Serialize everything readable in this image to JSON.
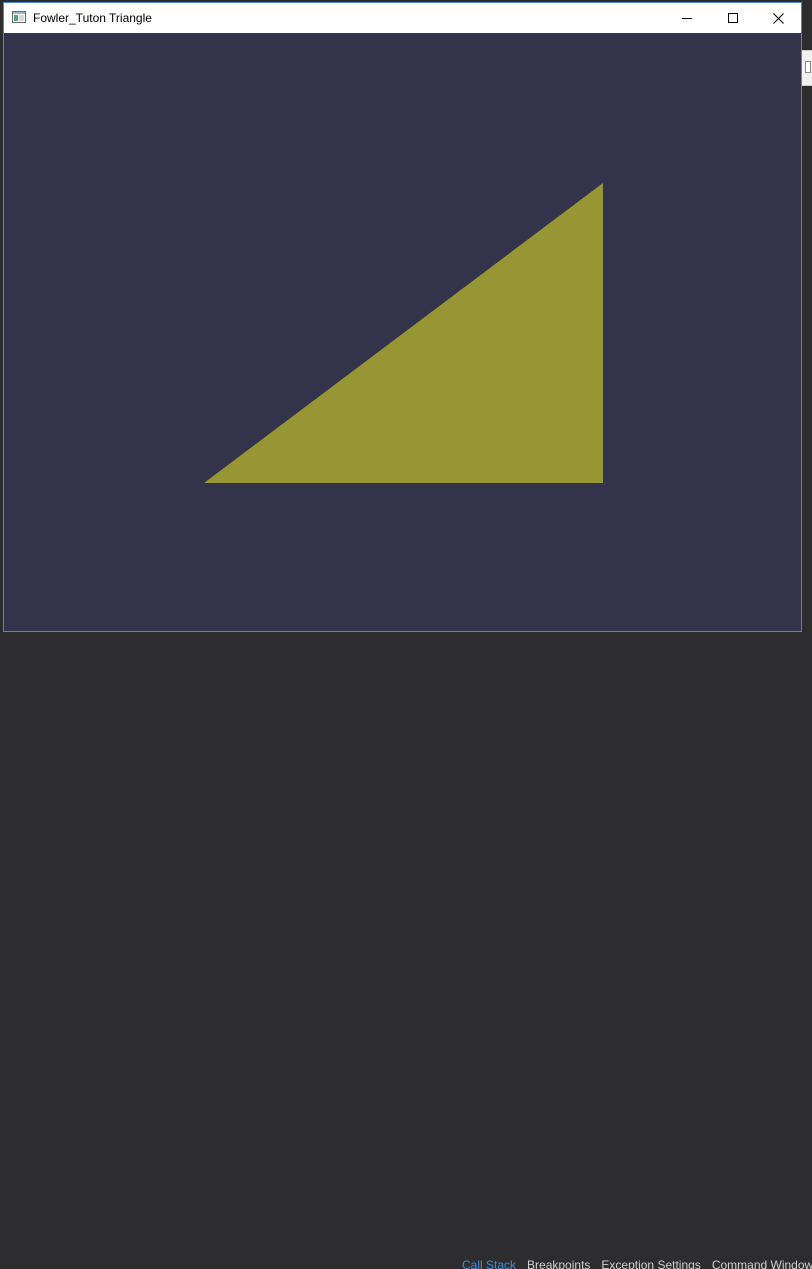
{
  "window": {
    "title": "Fowler_Tuton Triangle",
    "client_color": "#33334b",
    "frame_color": "#4a8ad4"
  },
  "controls": {
    "minimize_icon": "minimize-icon",
    "maximize_icon": "maximize-icon",
    "close_icon": "close-icon"
  },
  "scene": {
    "shape": "triangle",
    "fill": "#979534"
  },
  "background_app": {
    "tabs": [
      {
        "label": "Call Stack",
        "active": true
      },
      {
        "label": "Breakpoints",
        "active": false
      },
      {
        "label": "Exception Settings",
        "active": false
      },
      {
        "label": "Command Window",
        "active": false
      }
    ]
  }
}
